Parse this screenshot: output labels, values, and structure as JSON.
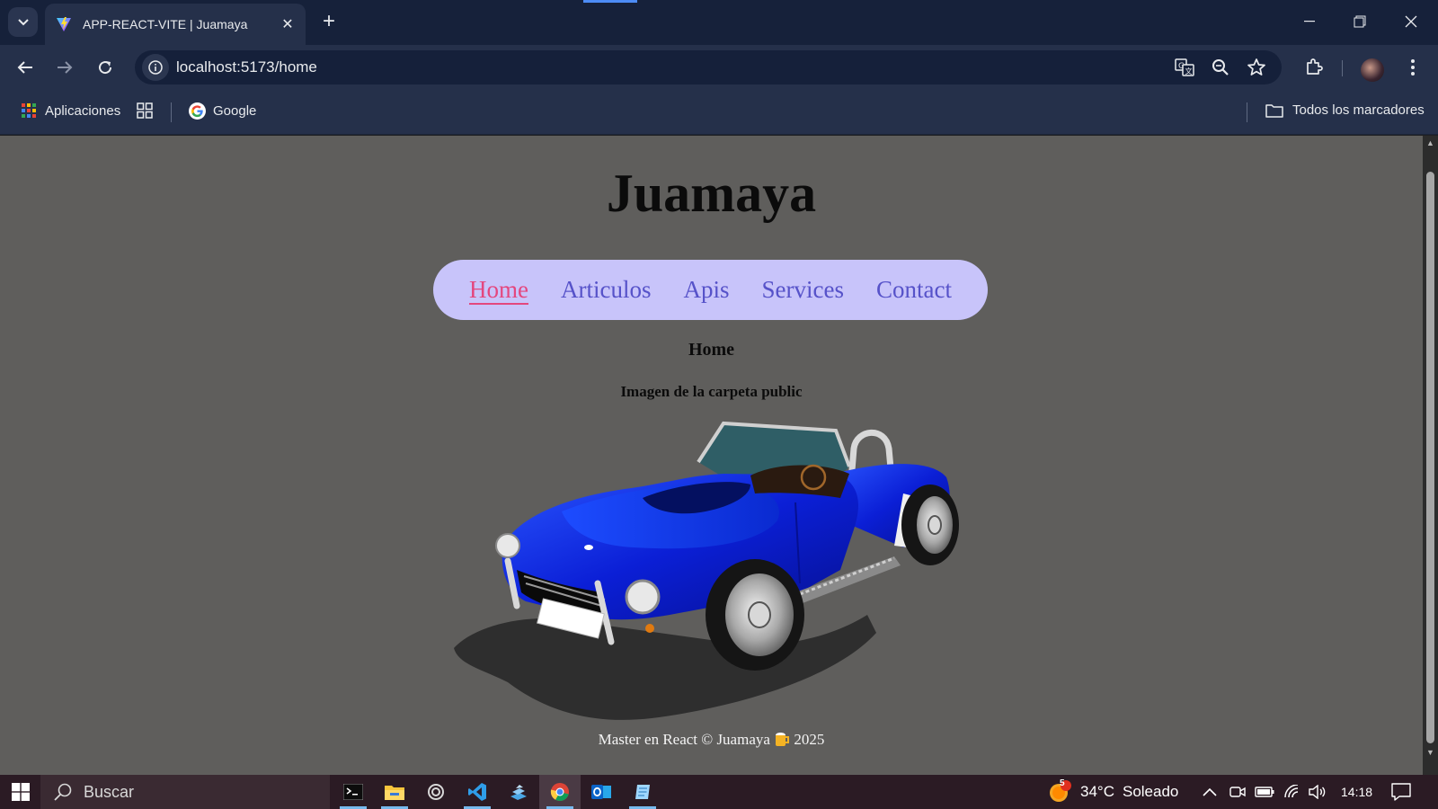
{
  "browser": {
    "tab": {
      "title": "APP-REACT-VITE | Juamaya"
    },
    "url": "localhost:5173/home",
    "bookmarks": {
      "apps_label": "Aplicaciones",
      "google_label": "Google",
      "all_bookmarks_label": "Todos los marcadores"
    }
  },
  "page": {
    "site_title": "Juamaya",
    "nav": [
      {
        "label": "Home",
        "active": true
      },
      {
        "label": "Articulos",
        "active": false
      },
      {
        "label": "Apis",
        "active": false
      },
      {
        "label": "Services",
        "active": false
      },
      {
        "label": "Contact",
        "active": false
      }
    ],
    "heading": "Home",
    "image_caption": "Imagen de la carpeta public",
    "footer": {
      "text": "Master en React © Juamaya",
      "year": "2025"
    }
  },
  "taskbar": {
    "search_placeholder": "Buscar",
    "weather": {
      "badge": "5",
      "temp": "34°C",
      "condition": "Soleado"
    },
    "time": "14:18"
  },
  "colors": {
    "page_bg": "#5f5e5c",
    "nav_bg": "#c8c4fa",
    "nav_link": "#5652c9",
    "nav_active": "#e4477e",
    "car_body": "#0b1fd6"
  }
}
